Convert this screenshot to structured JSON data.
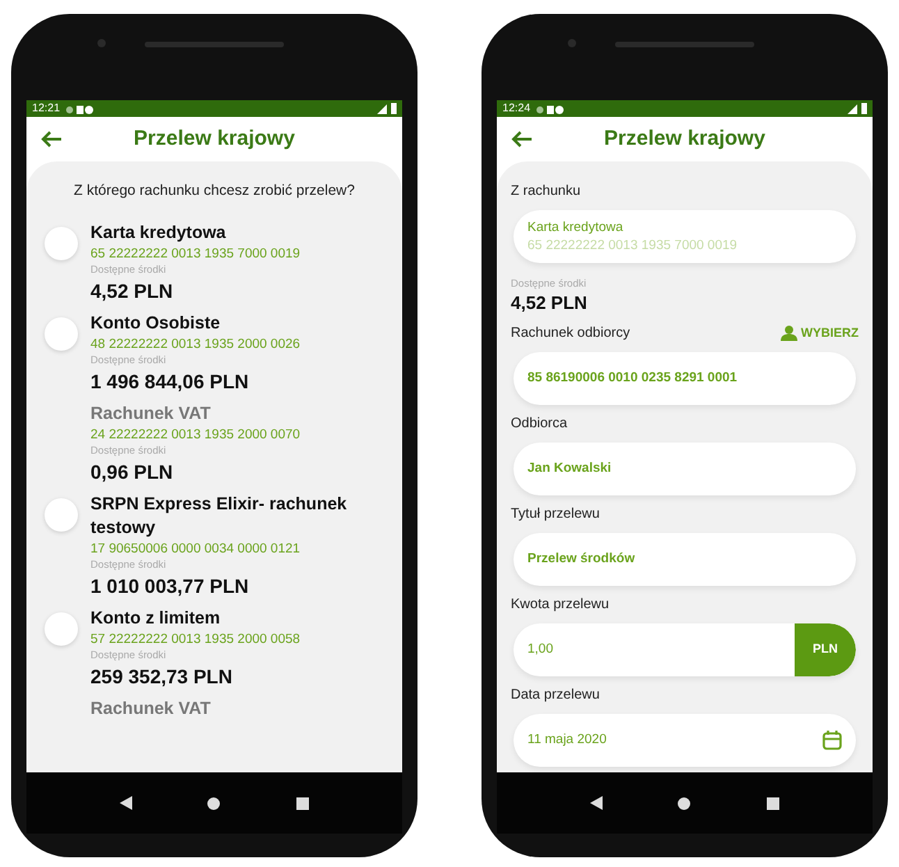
{
  "left_screen": {
    "status_bar": {
      "time": "12:21"
    },
    "title": "Przelew krajowy",
    "question": "Z którego rachunku chcesz zrobić przelew?",
    "accounts": [
      {
        "kind": "account",
        "selected": false,
        "name": "Karta kredytowa",
        "number": "65 22222222 0013 1935 7000 0019",
        "balance_label": "Dostępne środki",
        "balance": "4,52 PLN"
      },
      {
        "kind": "account",
        "selected": false,
        "name": "Konto Osobiste",
        "number": "48 22222222 0013 1935 2000 0026",
        "balance_label": "Dostępne środki",
        "balance": "1 496 844,06 PLN"
      },
      {
        "kind": "sub",
        "name": "Rachunek VAT",
        "number": "24 22222222 0013 1935 2000 0070",
        "balance_label": "Dostępne środki",
        "balance": "0,96 PLN"
      },
      {
        "kind": "account",
        "selected": false,
        "name": "SRPN Express Elixir- rachunek testowy",
        "number": "17 90650006 0000 0034 0000 0121",
        "balance_label": "Dostępne środki",
        "balance": "1 010 003,77 PLN"
      },
      {
        "kind": "account",
        "selected": false,
        "name": "Konto z limitem",
        "number": "57 22222222 0013 1935 2000 0058",
        "balance_label": "Dostępne środki",
        "balance": "259 352,73 PLN"
      },
      {
        "kind": "sub",
        "name": "Rachunek VAT"
      }
    ]
  },
  "right_screen": {
    "status_bar": {
      "time": "12:24"
    },
    "title": "Przelew krajowy",
    "from_account": {
      "label": "Z rachunku",
      "name": "Karta kredytowa",
      "number": "65 22222222 0013 1935 7000 0019"
    },
    "balance_label": "Dostępne środki",
    "balance": "4,52 PLN",
    "fields": [
      {
        "kind": "text",
        "label": "Rachunek odbiorcy",
        "action": "WYBIERZ",
        "value": "85 86190006 0010 0235 8291 0001"
      },
      {
        "kind": "text",
        "label": "Odbiorca",
        "value": "Jan Kowalski"
      },
      {
        "kind": "text",
        "label": "Tytuł przelewu",
        "value": "Przelew środków"
      },
      {
        "kind": "amount",
        "label": "Kwota przelewu",
        "value": "1,00",
        "currency": "PLN"
      },
      {
        "kind": "date",
        "label": "Data przelewu",
        "value": "11 maja 2020"
      }
    ]
  }
}
